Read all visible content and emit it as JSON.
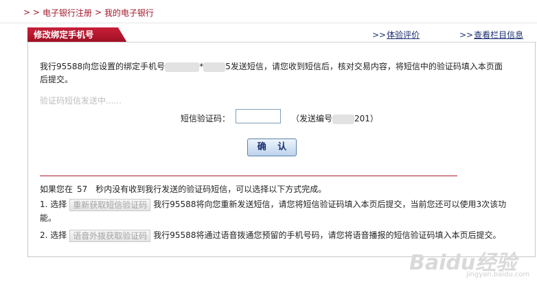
{
  "breadcrumb": {
    "chevrons": "> >",
    "items": [
      "电子银行注册",
      "我的电子银行"
    ],
    "separator": ">"
  },
  "tab": {
    "title": "修改绑定手机号"
  },
  "links": {
    "eval": {
      "arrow": ">>",
      "label": "体验评价"
    },
    "info": {
      "arrow": ">>",
      "label": "查看栏目信息"
    }
  },
  "message": {
    "part1": "我行95588向您设置的绑定手机号",
    "part2": "*",
    "part3": "5发送短信，请您收到短信后，核对交易内容，将短信中的验证码填入本页面后提交。"
  },
  "sending_status": "验证码短信发送中......",
  "code": {
    "label": "短信验证码：",
    "value": "",
    "serial_prefix": "（发送编号",
    "serial_suffix": "201）"
  },
  "confirm_button": "确 认",
  "resend": {
    "prefix": "如果您在",
    "seconds": "57",
    "suffix": "秒内没有收到我行发送的验证码短信，可以选择以下方式完成。"
  },
  "options": [
    {
      "prefix": "1. 选择",
      "button": "重新获取短信验证码",
      "text": "我行95588将向您重新发送短信，请您将短信验证码填入本页后提交，当前您还可以使用3次该功能。"
    },
    {
      "prefix": "2. 选择",
      "button": "语音外拨获取验证码",
      "text": "我行95588将通过语音拨通您预留的手机号码，请您将语音播报的短信验证码填入本页后提交。"
    }
  ],
  "watermark": {
    "logo": "Baidu经验",
    "url": "jingyan.baidu.com"
  }
}
